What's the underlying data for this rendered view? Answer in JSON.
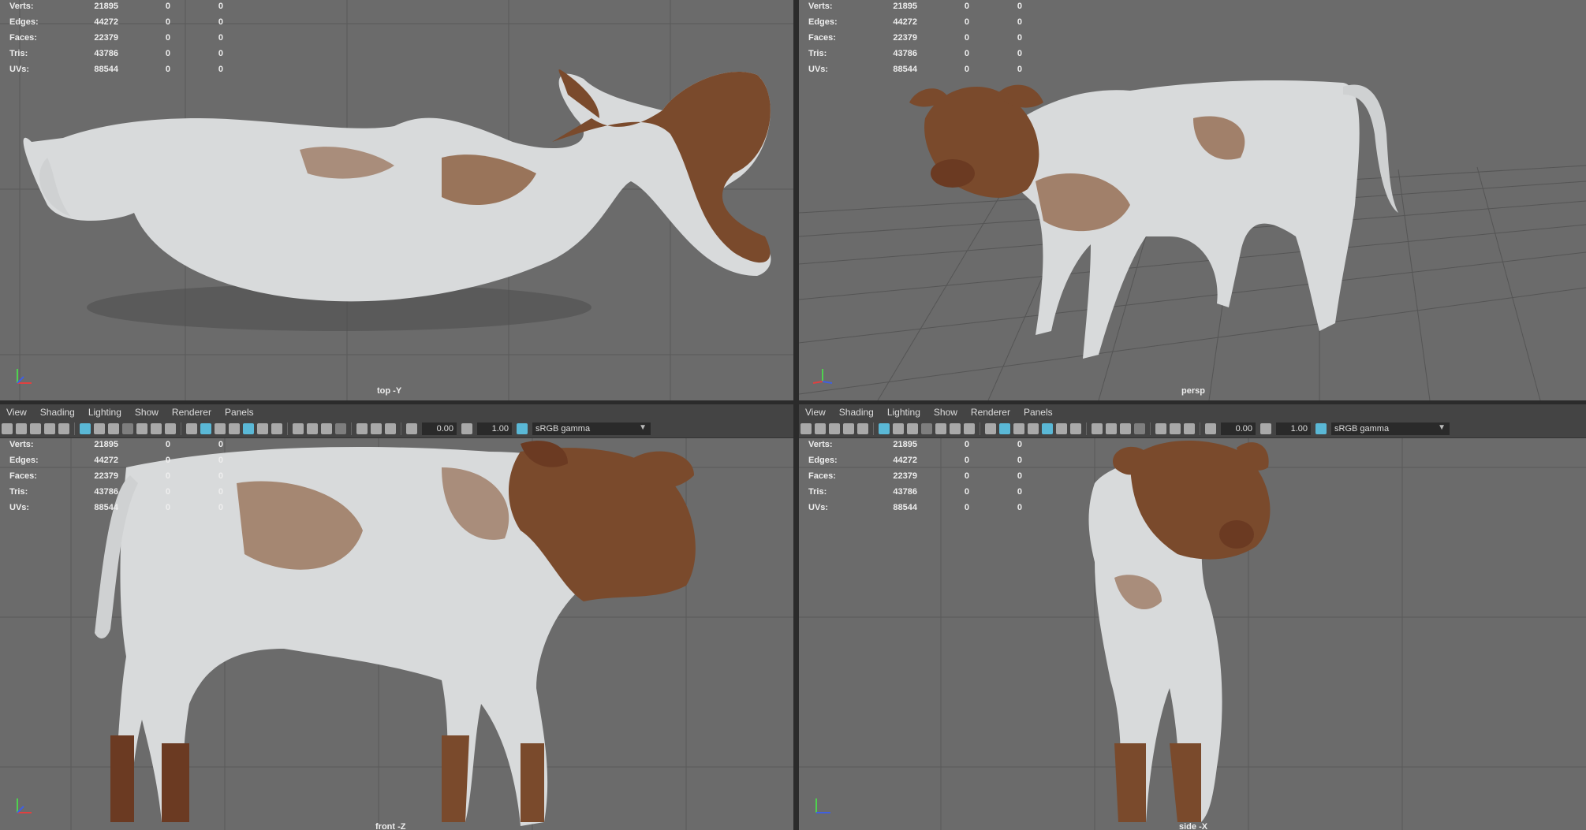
{
  "menu": [
    "View",
    "Shading",
    "Lighting",
    "Show",
    "Renderer",
    "Panels"
  ],
  "toolbar": {
    "exposure": "0.00",
    "gamma": "1.00",
    "colorspace": "sRGB gamma"
  },
  "stats": [
    {
      "label": "Verts:",
      "v1": "21895",
      "v2": "0",
      "v3": "0"
    },
    {
      "label": "Edges:",
      "v1": "44272",
      "v2": "0",
      "v3": "0"
    },
    {
      "label": "Faces:",
      "v1": "22379",
      "v2": "0",
      "v3": "0"
    },
    {
      "label": "Tris:",
      "v1": "43786",
      "v2": "0",
      "v3": "0"
    },
    {
      "label": "UVs:",
      "v1": "88544",
      "v2": "0",
      "v3": "0"
    }
  ],
  "viewports": {
    "top": "top -Y",
    "persp": "persp",
    "front": "front -Z",
    "side": "side -X"
  },
  "axis": {
    "y": "y",
    "x": "x",
    "z": "z"
  },
  "colors": {
    "viewport_bg": "#6b6b6b",
    "panel_bar": "#444444",
    "accent": "#5ab8d6",
    "cow_white": "#d8dadb",
    "cow_brown": "#7a4a2c"
  }
}
